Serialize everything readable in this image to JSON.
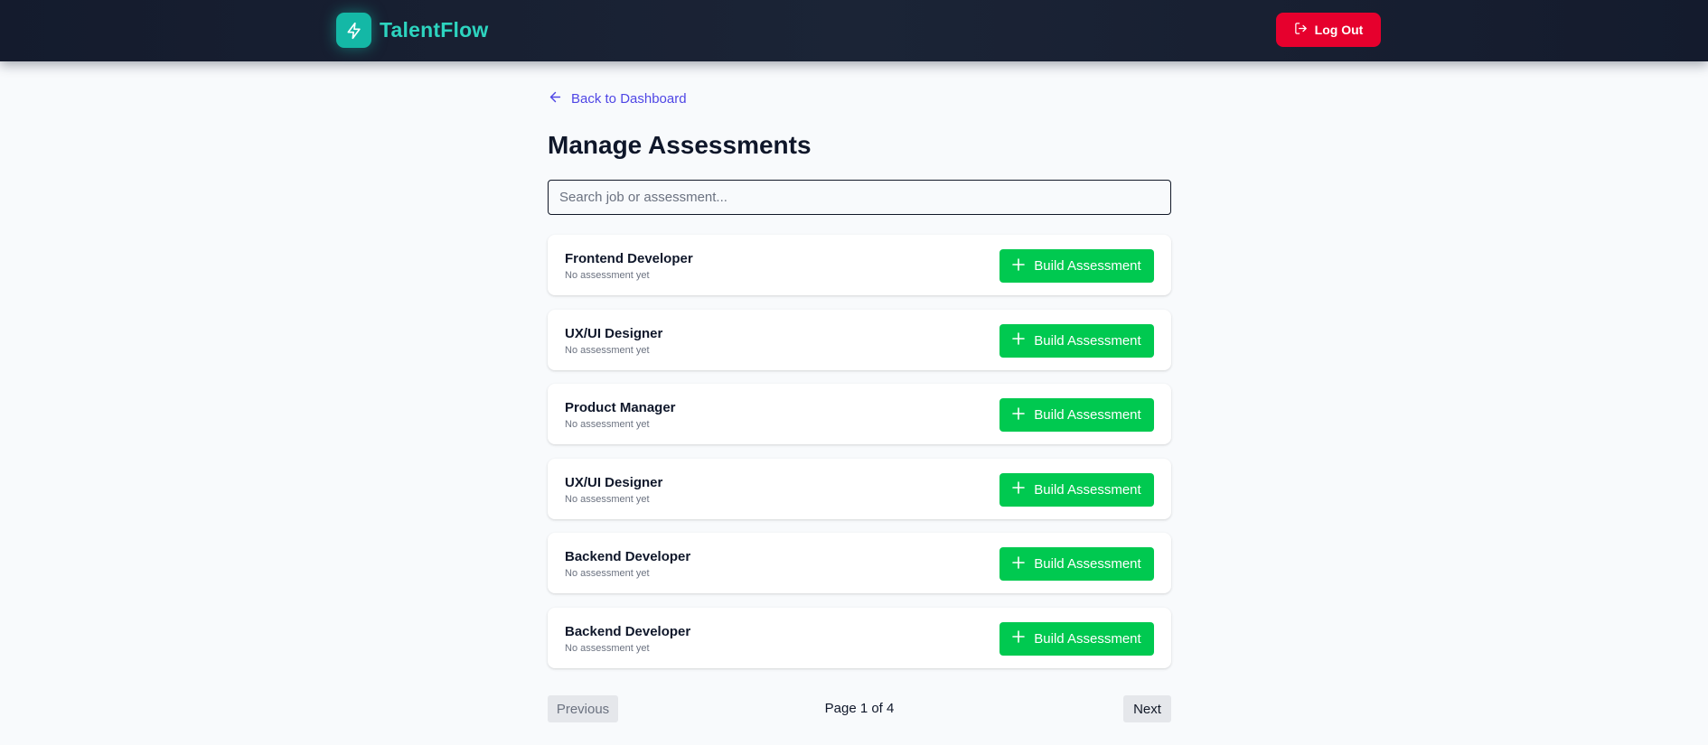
{
  "header": {
    "brand_name": "TalentFlow",
    "brand_icon": "lightning-bolt-icon",
    "logout_label": "Log Out",
    "logout_icon": "logout-icon"
  },
  "colors": {
    "accent": "#2dd4bf",
    "danger": "#e6002d",
    "success": "#00c950",
    "link": "#4f46e5"
  },
  "main": {
    "back_label": "Back to Dashboard",
    "title": "Manage Assessments",
    "search": {
      "placeholder": "Search job or assessment...",
      "value": ""
    },
    "jobs": [
      {
        "title": "Frontend Developer",
        "status": "No assessment yet",
        "action": "Build Assessment"
      },
      {
        "title": "UX/UI Designer",
        "status": "No assessment yet",
        "action": "Build Assessment"
      },
      {
        "title": "Product Manager",
        "status": "No assessment yet",
        "action": "Build Assessment"
      },
      {
        "title": "UX/UI Designer",
        "status": "No assessment yet",
        "action": "Build Assessment"
      },
      {
        "title": "Backend Developer",
        "status": "No assessment yet",
        "action": "Build Assessment"
      },
      {
        "title": "Backend Developer",
        "status": "No assessment yet",
        "action": "Build Assessment"
      }
    ],
    "pagination": {
      "previous_label": "Previous",
      "page_text": "Page 1 of 4",
      "next_label": "Next"
    }
  }
}
